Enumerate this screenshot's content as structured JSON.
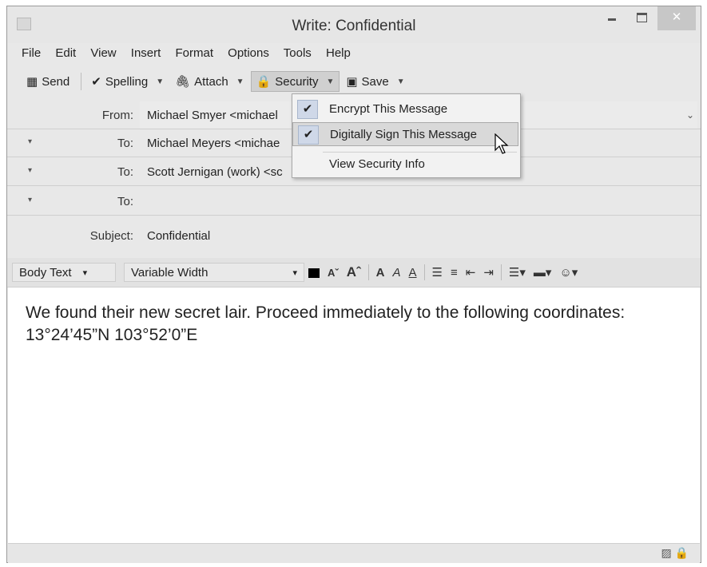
{
  "window": {
    "title": "Write: Confidential",
    "close_glyph": "✕"
  },
  "menubar": {
    "items": [
      {
        "label": "File"
      },
      {
        "label": "Edit"
      },
      {
        "label": "View"
      },
      {
        "label": "Insert"
      },
      {
        "label": "Format"
      },
      {
        "label": "Options"
      },
      {
        "label": "Tools"
      },
      {
        "label": "Help"
      }
    ]
  },
  "toolbar": {
    "send_label": "Send",
    "spelling_label": "Spelling",
    "attach_label": "Attach",
    "security_label": "Security",
    "save_label": "Save"
  },
  "headers": {
    "from_label": "From:",
    "from_value": "Michael Smyer <michael",
    "to_label": "To:",
    "to_rows": [
      {
        "value": "Michael Meyers <michae"
      },
      {
        "value": "Scott Jernigan (work) <sc"
      },
      {
        "value": ""
      }
    ],
    "subject_label": "Subject:",
    "subject_value": "Confidential"
  },
  "format": {
    "paragraph_style": "Body Text",
    "font": "Variable Width"
  },
  "message": {
    "body": "We found their new secret lair. Proceed immediately to the following coordinates:\n13°24’45”N 103°52’0”E"
  },
  "security_menu": {
    "items": [
      {
        "label": "Encrypt This Message",
        "checked": true
      },
      {
        "label": "Digitally Sign This Message",
        "checked": true
      },
      {
        "label": "View Security Info",
        "checked": false
      }
    ]
  },
  "colors": {
    "titlebar": "#e6e6e6",
    "menu_bg": "#f2f2f2",
    "check_highlight": "#cfd8e8"
  }
}
